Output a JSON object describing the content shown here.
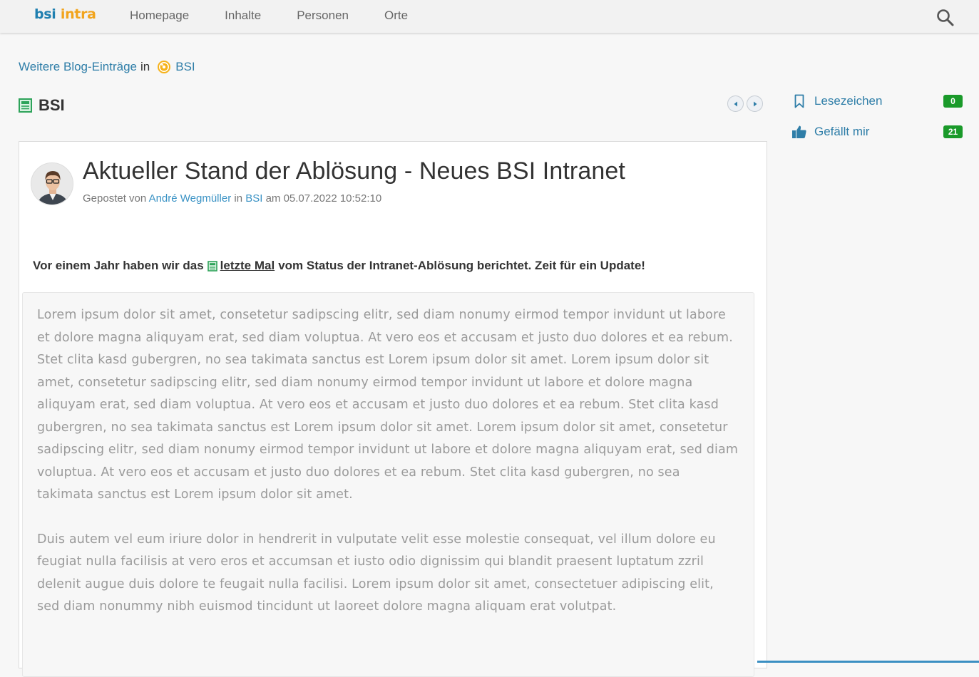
{
  "header": {
    "logo_part1": "bsi",
    "logo_part2": "intra",
    "nav": [
      "Homepage",
      "Inhalte",
      "Personen",
      "Orte"
    ]
  },
  "breadcrumb": {
    "link_text": "Weitere Blog-Einträge",
    "in": "in",
    "space": "BSI"
  },
  "section": {
    "title": "BSI"
  },
  "post": {
    "title": "Aktueller Stand der Ablösung - Neues BSI Intranet",
    "meta_prefix": "Gepostet von",
    "author": "André Wegmüller",
    "meta_in": "in",
    "space": "BSI",
    "meta_date": "am 05.07.2022 10:52:10",
    "intro_before": "Vor einem Jahr haben wir das",
    "intro_link": "letzte Mal",
    "intro_after": "vom Status der Intranet-Ablösung berichtet. Zeit für ein Update!",
    "paragraphs": [
      "Lorem ipsum dolor sit amet, consetetur sadipscing elitr, sed diam nonumy eirmod tempor invidunt ut labore et dolore magna aliquyam erat, sed diam voluptua. At vero eos et accusam et justo duo dolores et ea rebum. Stet clita kasd gubergren, no sea takimata sanctus est Lorem ipsum dolor sit amet. Lorem ipsum dolor sit amet, consetetur sadipscing elitr, sed diam nonumy eirmod tempor invidunt ut labore et dolore magna aliquyam erat, sed diam voluptua. At vero eos et accusam et justo duo dolores et ea rebum. Stet clita kasd gubergren, no sea takimata sanctus est Lorem ipsum dolor sit amet. Lorem ipsum dolor sit amet, consetetur sadipscing elitr, sed diam nonumy eirmod tempor invidunt ut labore et dolore magna aliquyam erat, sed diam voluptua. At vero eos et accusam et justo duo dolores et ea rebum. Stet clita kasd gubergren, no sea takimata sanctus est Lorem ipsum dolor sit amet.",
      "Duis autem vel eum iriure dolor in hendrerit in vulputate velit esse molestie consequat, vel illum dolore eu feugiat nulla facilisis at vero eros et accumsan et iusto odio dignissim qui blandit praesent luptatum zzril delenit augue duis dolore te feugait nulla facilisi. Lorem ipsum dolor sit amet, consectetuer adipiscing elit, sed diam nonummy nibh euismod tincidunt ut laoreet dolore magna aliquam erat volutpat."
    ]
  },
  "sidebar": {
    "bookmark_label": "Lesezeichen",
    "bookmark_count": "0",
    "like_label": "Gefällt mir",
    "like_count": "21"
  },
  "icons": {
    "search": "search-icon",
    "space": "bsi-space-icon",
    "document": "document-icon",
    "prev": "arrow-left-icon",
    "next": "arrow-right-icon",
    "bookmark": "bookmark-icon",
    "like": "thumbs-up-icon"
  },
  "colors": {
    "link": "#2f7ea8",
    "logo_blue": "#1f7fb0",
    "logo_orange": "#f2a41c",
    "badge_green": "#1a9a2a"
  }
}
